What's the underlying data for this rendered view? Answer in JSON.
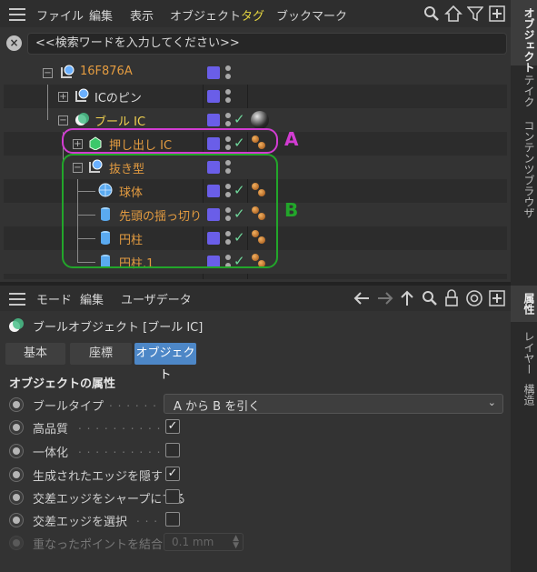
{
  "object_manager": {
    "menu": [
      "ファイル",
      "編集",
      "表示",
      "オブジェクト",
      "タグ",
      "ブックマーク"
    ],
    "active_menu": "タグ",
    "search": {
      "placeholder": "<<検索ワードを入力してください>>",
      "value": ""
    },
    "tree": [
      {
        "name": "16F876A",
        "color": "orange",
        "type": "null"
      },
      {
        "name": "ICのピン",
        "color": "white",
        "type": "null"
      },
      {
        "name": "ブール IC",
        "color": "yellow",
        "type": "boole"
      },
      {
        "name": "押し出し IC",
        "color": "orange",
        "type": "extrude"
      },
      {
        "name": "抜き型",
        "color": "orange",
        "type": "null"
      },
      {
        "name": "球体",
        "color": "orange",
        "type": "sphere"
      },
      {
        "name": "先頭の揺っ切り",
        "color": "orange",
        "type": "cylinder"
      },
      {
        "name": "円柱",
        "color": "orange",
        "type": "cylinder"
      },
      {
        "name": "円柱.1",
        "color": "orange",
        "type": "cylinder"
      }
    ],
    "annotations": {
      "a_label": "A",
      "b_label": "B",
      "a_color": "#d23cd2",
      "b_color": "#22a62a"
    }
  },
  "side_tabs_top": [
    "オブジェクト",
    "テイク",
    "コンテンツブラウザ"
  ],
  "side_tabs_bottom": [
    "属性",
    "レイヤー",
    "構造"
  ],
  "attributes": {
    "menu": [
      "モード",
      "編集",
      "ユーザデータ"
    ],
    "title": "ブールオブジェクト [ブール IC]",
    "tabs": [
      "基本",
      "座標",
      "オブジェクト"
    ],
    "active_tab": "オブジェクト",
    "section": "オブジェクトの属性",
    "props": [
      {
        "label": "ブールタイプ",
        "type": "select",
        "value": "A から B を引く"
      },
      {
        "label": "高品質",
        "type": "checkbox",
        "checked": true
      },
      {
        "label": "一体化",
        "type": "checkbox",
        "checked": false
      },
      {
        "label": "生成されたエッジを隠す",
        "type": "checkbox",
        "checked": true
      },
      {
        "label": "交差エッジをシャープにする",
        "type": "checkbox",
        "checked": false
      },
      {
        "label": "交差エッジを選択",
        "type": "checkbox",
        "checked": false
      },
      {
        "label": "重なったポイントを結合",
        "type": "number",
        "value": "0.1 mm",
        "disabled": true
      }
    ]
  },
  "colors": {
    "accent_tag": "#e6d640",
    "layer": "#6a5ee8",
    "check": "#6fd69a",
    "tab_active": "#4d87c7"
  }
}
